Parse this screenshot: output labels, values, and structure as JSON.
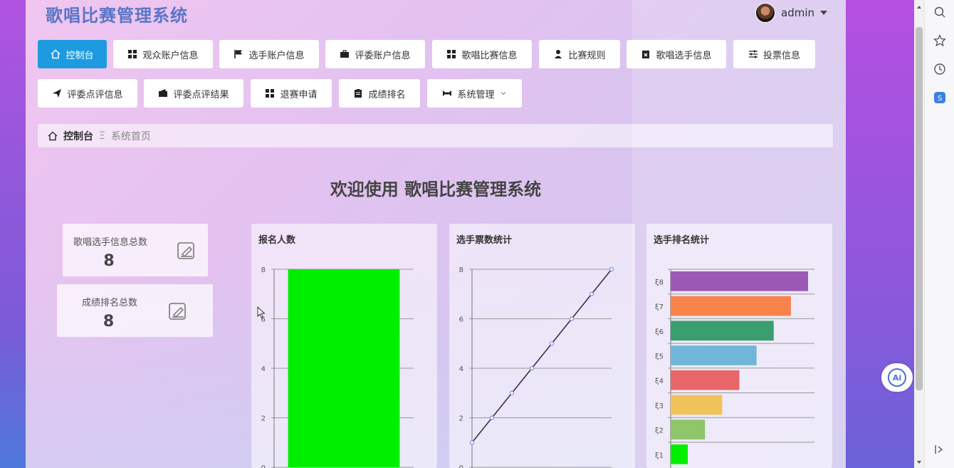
{
  "app": {
    "title": "歌唱比赛管理系统",
    "user": "admin"
  },
  "nav": [
    {
      "label": "控制台",
      "icon": "home-icon",
      "active": true
    },
    {
      "label": "观众账户信息",
      "icon": "grid-icon"
    },
    {
      "label": "选手账户信息",
      "icon": "flag-icon"
    },
    {
      "label": "评委账户信息",
      "icon": "briefcase-icon"
    },
    {
      "label": "歌唱比赛信息",
      "icon": "grid-icon"
    },
    {
      "label": "比赛规则",
      "icon": "user-icon"
    },
    {
      "label": "歌唱选手信息",
      "icon": "clipboard-x-icon"
    },
    {
      "label": "投票信息",
      "icon": "sliders-icon"
    },
    {
      "label": "评委点评信息",
      "icon": "send-icon"
    },
    {
      "label": "评委点评结果",
      "icon": "wallet-icon"
    },
    {
      "label": "退赛申请",
      "icon": "grid-icon"
    },
    {
      "label": "成绩排名",
      "icon": "clipboard-icon"
    },
    {
      "label": "系统管理",
      "icon": "tool-icon",
      "has_dropdown": true
    }
  ],
  "breadcrumb": {
    "home": "控制台",
    "separator": "Ξ",
    "current": "系统首页"
  },
  "welcome": "欢迎使用 歌唱比赛管理系统",
  "stats": [
    {
      "label": "歌唱选手信息总数",
      "value": "8"
    },
    {
      "label": "成绩排名总数",
      "value": "8"
    }
  ],
  "chart_data": [
    {
      "type": "bar",
      "title": "报名人数",
      "categories": [
        ""
      ],
      "values": [
        8
      ],
      "ylim": [
        0,
        8
      ],
      "yticks": [
        "0",
        "2",
        "4",
        "6",
        "8"
      ],
      "color": "#00ee00"
    },
    {
      "type": "line",
      "title": "选手票数统计",
      "x": [
        1,
        2,
        3,
        4,
        5,
        6,
        7,
        8
      ],
      "values": [
        1,
        2,
        3,
        4,
        5,
        6,
        7,
        8
      ],
      "ylim": [
        0,
        8
      ],
      "yticks": [
        "0",
        "2",
        "4",
        "6",
        "8"
      ],
      "color": "#3a2f4a",
      "marker_color": "#7f8fe0"
    },
    {
      "type": "bar",
      "orientation": "horizontal",
      "title": "选手排名统计",
      "categories": [
        "ξ8",
        "ξ7",
        "ξ6",
        "ξ5",
        "ξ4",
        "ξ3",
        "ξ2",
        "ξ1"
      ],
      "values": [
        8,
        7,
        6,
        5,
        4,
        3,
        2,
        1
      ],
      "colors": [
        "#9b59b6",
        "#f5834a",
        "#3a9e6e",
        "#6fb6d8",
        "#e8656a",
        "#f2c25a",
        "#8fc56b",
        "#00ee00"
      ]
    }
  ],
  "colors": {
    "accent": "#1e9be0",
    "title": "#5a76c8"
  }
}
